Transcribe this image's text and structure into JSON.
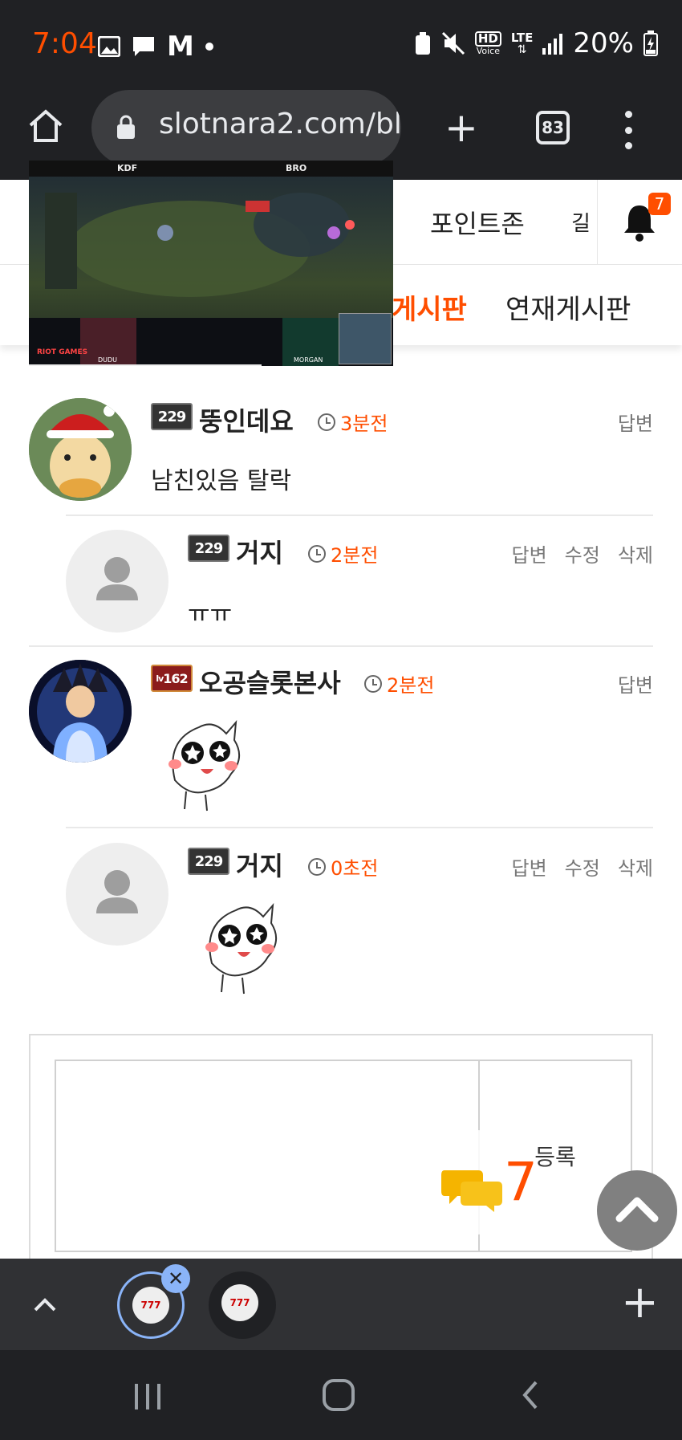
{
  "status": {
    "time": "7:04",
    "battery": "20%",
    "notif_glyph": "M",
    "hd_label": "HD",
    "voice_label": "Voice",
    "lte_label": "LTE"
  },
  "browser": {
    "url": "slotnara2.com/bl",
    "tab_count": "83"
  },
  "site": {
    "point_zone": "포인트존",
    "cut_text": "길",
    "notif_count": "7",
    "menu": [
      "게시판",
      "연재게시판"
    ]
  },
  "comments": [
    {
      "level": "229",
      "nick": "뚱인데요",
      "time": "3분전",
      "actions": [
        "답변"
      ],
      "body": "남친있음 탈락",
      "avatar": "duck-avatar"
    },
    {
      "level": "229",
      "nick": "거지",
      "time": "2분전",
      "actions": [
        "답변",
        "수정",
        "삭제"
      ],
      "body": "ㅠㅠ",
      "avatar": "default-avatar"
    },
    {
      "level": "lv162",
      "nick": "오공슬롯본사",
      "time": "2분전",
      "actions": [
        "답변"
      ],
      "body": "",
      "avatar": "goku-avatar",
      "sticker": "star-eyes-sticker"
    },
    {
      "level": "229",
      "nick": "거지",
      "time": "0초전",
      "actions": [
        "답변",
        "수정",
        "삭제"
      ],
      "body": "",
      "avatar": "default-avatar",
      "sticker": "star-eyes-sticker"
    }
  ],
  "level_labels": {
    "lv": "lv",
    "num": "162"
  },
  "write": {
    "register": "등록"
  },
  "chat": {
    "count": "7"
  },
  "video": {
    "team_left": "KDF",
    "team_right": "BRO",
    "player_left": "DUDU",
    "player_right": "MORGAN",
    "brand": "RIOT GAMES"
  },
  "colors": {
    "accent": "#ff4e00",
    "chrome": "#202124"
  }
}
